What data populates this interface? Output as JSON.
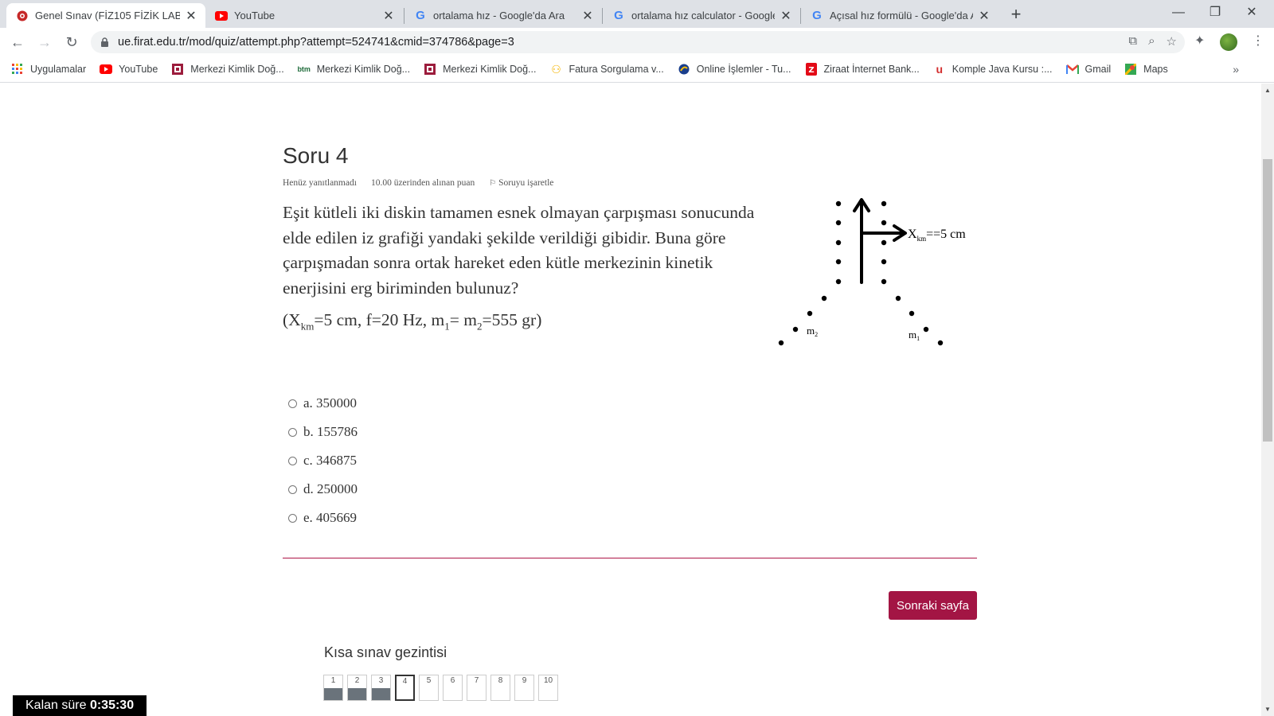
{
  "browser": {
    "tabs": [
      {
        "title": "Genel Sınav (FİZ105 FİZİK LABOR",
        "icon": "moodle-icon",
        "active": true
      },
      {
        "title": "YouTube",
        "icon": "youtube-icon",
        "active": false
      },
      {
        "title": "ortalama hız - Google'da Ara",
        "icon": "google-icon",
        "active": false
      },
      {
        "title": "ortalama hız calculator - Google",
        "icon": "google-icon",
        "active": false
      },
      {
        "title": "Açısal hız formülü - Google'da Ar",
        "icon": "google-icon",
        "active": false
      }
    ],
    "url": "ue.firat.edu.tr/mod/quiz/attempt.php?attempt=524741&cmid=374786&page=3",
    "bookmarks": [
      {
        "label": "Uygulamalar",
        "icon": "apps-grid-icon"
      },
      {
        "label": "YouTube",
        "icon": "youtube-icon"
      },
      {
        "label": "Merkezi Kimlik Doğ...",
        "icon": "kimlik-icon"
      },
      {
        "label": "Merkezi Kimlik Doğ...",
        "icon": "btm-icon"
      },
      {
        "label": "Merkezi Kimlik Doğ...",
        "icon": "kimlik-icon"
      },
      {
        "label": "Fatura Sorgulama v...",
        "icon": "fatura-icon"
      },
      {
        "label": "Online İşlemler - Tu...",
        "icon": "turkcell-icon"
      },
      {
        "label": "Ziraat İnternet Bank...",
        "icon": "ziraat-icon"
      },
      {
        "label": "Komple Java Kursu :...",
        "icon": "udemy-icon"
      },
      {
        "label": "Gmail",
        "icon": "gmail-icon"
      },
      {
        "label": "Maps",
        "icon": "maps-icon"
      }
    ]
  },
  "question": {
    "title": "Soru 4",
    "status": "Henüz yanıtlanmadı",
    "points": "10.00 üzerinden alınan puan",
    "flag_label": "Soruyu işaretle",
    "text": "Eşit kütleli iki diskin tamamen esnek olmayan çarpışması sonucunda elde edilen iz grafiği yandaki şekilde verildiği gibidir. Buna göre çarpışmadan sonra ortak hareket eden kütle merkezinin kinetik enerjisini erg biriminden bulunuz?",
    "params": {
      "open": "(X",
      "sub_km": "km",
      "p1": "=5 cm, f=20 Hz, m",
      "sub1": "1",
      "p2": "= m",
      "sub2": "2",
      "p3": "=555 gr)"
    },
    "diagram": {
      "label_x": "X",
      "label_x_sub": "km",
      "label_x_value": "==5 cm",
      "label_m_left": "m",
      "label_m_left_sub": "2",
      "label_m_right": "m",
      "label_m_right_sub": "1"
    },
    "answers": [
      "a. 350000",
      "b. 155786",
      "c. 346875",
      "d. 250000",
      "e. 405669"
    ]
  },
  "next_button": "Sonraki sayfa",
  "nav": {
    "title": "Kısa sınav gezintisi",
    "items": [
      {
        "num": "1",
        "state": "answered"
      },
      {
        "num": "2",
        "state": "answered"
      },
      {
        "num": "3",
        "state": "answered"
      },
      {
        "num": "4",
        "state": "current"
      },
      {
        "num": "5",
        "state": "empty"
      },
      {
        "num": "6",
        "state": "empty"
      },
      {
        "num": "7",
        "state": "empty"
      },
      {
        "num": "8",
        "state": "empty"
      },
      {
        "num": "9",
        "state": "empty"
      },
      {
        "num": "10",
        "state": "empty"
      }
    ]
  },
  "timer": {
    "label": "Kalan süre",
    "value": "0:35:30"
  },
  "colors": {
    "accent": "#a31544",
    "divider": "#ad1546",
    "answered": "#6a737b"
  }
}
